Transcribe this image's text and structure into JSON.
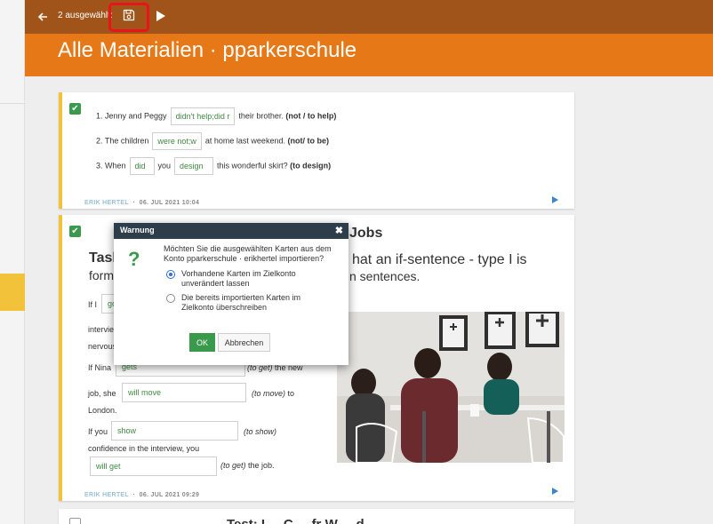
{
  "toolbar": {
    "selection_label": "2 ausgewählt:",
    "back_icon": "arrow-left-icon",
    "save_icon": "floppy-disk-icon",
    "play_icon": "play-icon"
  },
  "header": {
    "title": "Alle Materialien · pparkerschule"
  },
  "card1": {
    "q1": {
      "prefix": "1. Jenny and Peggy",
      "answer": "didn't help;did r",
      "suffix": "their brother.",
      "hint": "(not / to help)"
    },
    "q2": {
      "prefix": "2. The children",
      "answer": "were not;w",
      "suffix": "at home last weekend.",
      "hint": "(not/ to be)"
    },
    "q3": {
      "prefix": "3. When",
      "answer1": "did",
      "mid": "you",
      "answer2": "design",
      "suffix": "this wonderful skirt?",
      "hint": "(to design)"
    },
    "author": "ERIK HERTEL",
    "separator": "·",
    "date": "06. JUL 2021 10:04"
  },
  "card2": {
    "title_visible": "Jobs",
    "task_label": "Task",
    "form_label": "form",
    "instruction_right1": "hat an if-sentence - type I is",
    "instruction_right2": "n sentences.",
    "line_if_i": "If I",
    "field_go": "go",
    "line_interview": "intervie",
    "line_nervous": "nervous",
    "line_if_nina": "If Nina",
    "field_gets": "gets",
    "hint_to_get": "(to get)",
    "after_to_get": "the new",
    "line_job_she": "job, she",
    "field_will_move": "will move",
    "hint_to_move": "(to move)",
    "after_to_move": "to",
    "line_london": "London.",
    "line_if_you": "If you",
    "field_show": "show",
    "hint_to_show": "(to show)",
    "line_confidence": "confidence in the interview, you",
    "field_will_get": "will get",
    "hint_to_get2": "(to get)",
    "after_to_get2": "the job.",
    "author": "ERIK HERTEL",
    "separator": "·",
    "date": "06. JUL 2021 09:29"
  },
  "card3": {
    "title_partial": "Test: I ... C ... fr W ... d"
  },
  "dialog": {
    "title": "Warnung",
    "close_icon": "close-icon",
    "question_icon": "question-mark-icon",
    "message": "Möchten Sie die ausgewählten Karten aus dem Konto pparkerschule · erikhertel importieren?",
    "option1": "Vorhandene Karten im Zielkonto unverändert lassen",
    "option2": "Die bereits importierten Karten im Zielkonto überschreiben",
    "selected_option": 1,
    "ok_label": "OK",
    "cancel_label": "Abbrechen"
  },
  "colors": {
    "toolbar": "#a0541a",
    "header": "#e67817",
    "card_accent": "#f2c23a",
    "check_green": "#3a9a4c",
    "highlight_red": "#e8141a",
    "dialog_header": "#2e3d4a"
  }
}
